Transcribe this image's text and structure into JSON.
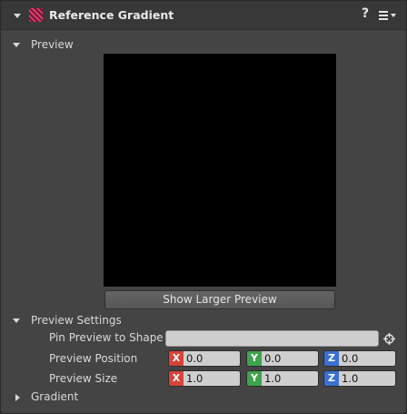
{
  "header": {
    "title": "Reference Gradient",
    "help_glyph": "?"
  },
  "preview": {
    "section_label": "Preview",
    "larger_button": "Show Larger Preview"
  },
  "settings": {
    "section_label": "Preview Settings",
    "pin_label": "Pin Preview to Shape",
    "pin_value": "",
    "position_label": "Preview Position",
    "position": {
      "x_tag": "X",
      "x": "0.0",
      "y_tag": "Y",
      "y": "0.0",
      "z_tag": "Z",
      "z": "0.0"
    },
    "size_label": "Preview Size",
    "size": {
      "x_tag": "X",
      "x": "1.0",
      "y_tag": "Y",
      "y": "1.0",
      "z_tag": "Z",
      "z": "1.0"
    }
  },
  "gradient": {
    "section_label": "Gradient"
  },
  "colors": {
    "accent_icon": "#e03b67",
    "x_axis": "#d8443a",
    "y_axis": "#3fa34d",
    "z_axis": "#3b6fd1"
  },
  "icons": [
    "collapse-triangle-icon",
    "gradient-icon",
    "help-icon",
    "menu-icon",
    "target-icon",
    "expand-triangle-icon"
  ]
}
